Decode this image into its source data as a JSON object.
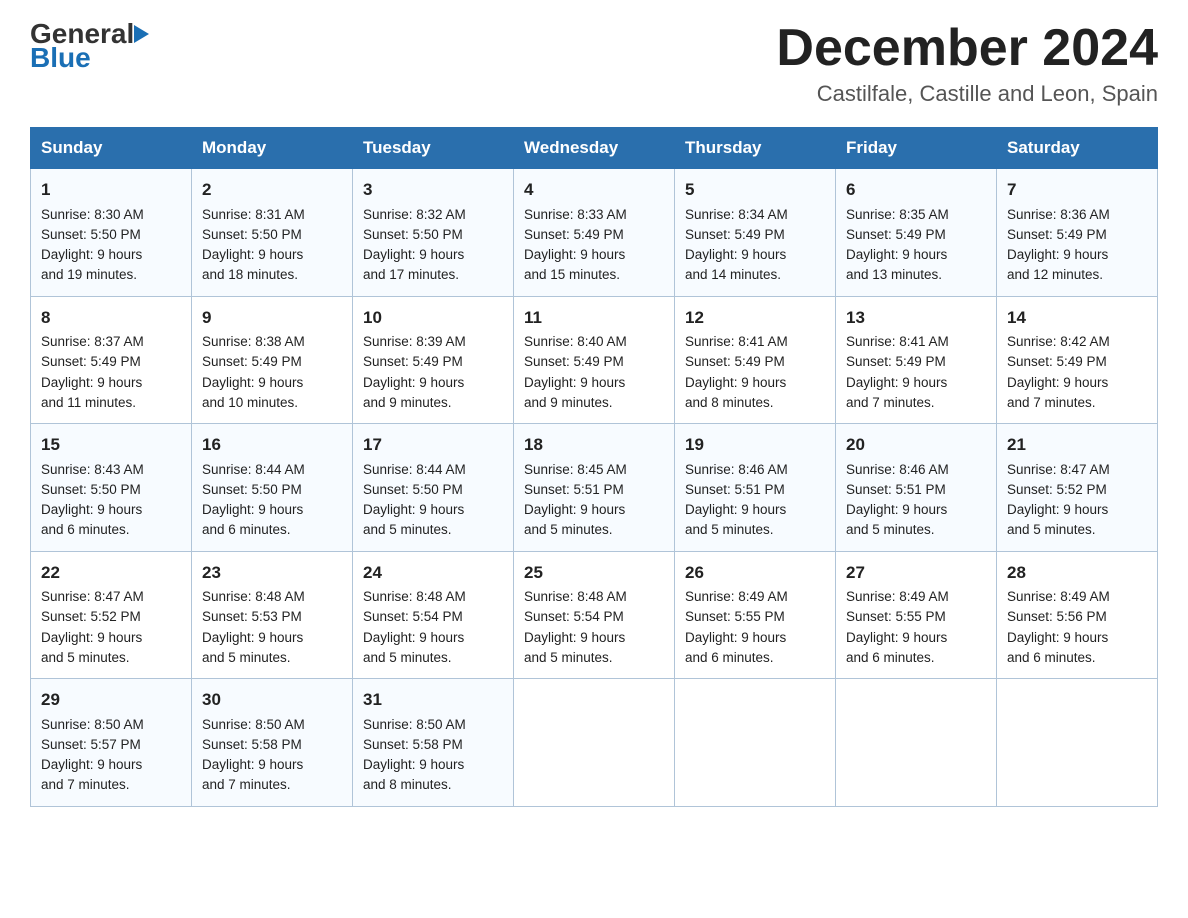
{
  "header": {
    "logo_general": "General",
    "logo_blue": "Blue",
    "main_title": "December 2024",
    "subtitle": "Castilfale, Castille and Leon, Spain"
  },
  "calendar": {
    "days": [
      "Sunday",
      "Monday",
      "Tuesday",
      "Wednesday",
      "Thursday",
      "Friday",
      "Saturday"
    ],
    "weeks": [
      [
        {
          "day": "1",
          "sunrise": "8:30 AM",
          "sunset": "5:50 PM",
          "daylight": "9 hours and 19 minutes."
        },
        {
          "day": "2",
          "sunrise": "8:31 AM",
          "sunset": "5:50 PM",
          "daylight": "9 hours and 18 minutes."
        },
        {
          "day": "3",
          "sunrise": "8:32 AM",
          "sunset": "5:50 PM",
          "daylight": "9 hours and 17 minutes."
        },
        {
          "day": "4",
          "sunrise": "8:33 AM",
          "sunset": "5:49 PM",
          "daylight": "9 hours and 15 minutes."
        },
        {
          "day": "5",
          "sunrise": "8:34 AM",
          "sunset": "5:49 PM",
          "daylight": "9 hours and 14 minutes."
        },
        {
          "day": "6",
          "sunrise": "8:35 AM",
          "sunset": "5:49 PM",
          "daylight": "9 hours and 13 minutes."
        },
        {
          "day": "7",
          "sunrise": "8:36 AM",
          "sunset": "5:49 PM",
          "daylight": "9 hours and 12 minutes."
        }
      ],
      [
        {
          "day": "8",
          "sunrise": "8:37 AM",
          "sunset": "5:49 PM",
          "daylight": "9 hours and 11 minutes."
        },
        {
          "day": "9",
          "sunrise": "8:38 AM",
          "sunset": "5:49 PM",
          "daylight": "9 hours and 10 minutes."
        },
        {
          "day": "10",
          "sunrise": "8:39 AM",
          "sunset": "5:49 PM",
          "daylight": "9 hours and 9 minutes."
        },
        {
          "day": "11",
          "sunrise": "8:40 AM",
          "sunset": "5:49 PM",
          "daylight": "9 hours and 9 minutes."
        },
        {
          "day": "12",
          "sunrise": "8:41 AM",
          "sunset": "5:49 PM",
          "daylight": "9 hours and 8 minutes."
        },
        {
          "day": "13",
          "sunrise": "8:41 AM",
          "sunset": "5:49 PM",
          "daylight": "9 hours and 7 minutes."
        },
        {
          "day": "14",
          "sunrise": "8:42 AM",
          "sunset": "5:49 PM",
          "daylight": "9 hours and 7 minutes."
        }
      ],
      [
        {
          "day": "15",
          "sunrise": "8:43 AM",
          "sunset": "5:50 PM",
          "daylight": "9 hours and 6 minutes."
        },
        {
          "day": "16",
          "sunrise": "8:44 AM",
          "sunset": "5:50 PM",
          "daylight": "9 hours and 6 minutes."
        },
        {
          "day": "17",
          "sunrise": "8:44 AM",
          "sunset": "5:50 PM",
          "daylight": "9 hours and 5 minutes."
        },
        {
          "day": "18",
          "sunrise": "8:45 AM",
          "sunset": "5:51 PM",
          "daylight": "9 hours and 5 minutes."
        },
        {
          "day": "19",
          "sunrise": "8:46 AM",
          "sunset": "5:51 PM",
          "daylight": "9 hours and 5 minutes."
        },
        {
          "day": "20",
          "sunrise": "8:46 AM",
          "sunset": "5:51 PM",
          "daylight": "9 hours and 5 minutes."
        },
        {
          "day": "21",
          "sunrise": "8:47 AM",
          "sunset": "5:52 PM",
          "daylight": "9 hours and 5 minutes."
        }
      ],
      [
        {
          "day": "22",
          "sunrise": "8:47 AM",
          "sunset": "5:52 PM",
          "daylight": "9 hours and 5 minutes."
        },
        {
          "day": "23",
          "sunrise": "8:48 AM",
          "sunset": "5:53 PM",
          "daylight": "9 hours and 5 minutes."
        },
        {
          "day": "24",
          "sunrise": "8:48 AM",
          "sunset": "5:54 PM",
          "daylight": "9 hours and 5 minutes."
        },
        {
          "day": "25",
          "sunrise": "8:48 AM",
          "sunset": "5:54 PM",
          "daylight": "9 hours and 5 minutes."
        },
        {
          "day": "26",
          "sunrise": "8:49 AM",
          "sunset": "5:55 PM",
          "daylight": "9 hours and 6 minutes."
        },
        {
          "day": "27",
          "sunrise": "8:49 AM",
          "sunset": "5:55 PM",
          "daylight": "9 hours and 6 minutes."
        },
        {
          "day": "28",
          "sunrise": "8:49 AM",
          "sunset": "5:56 PM",
          "daylight": "9 hours and 6 minutes."
        }
      ],
      [
        {
          "day": "29",
          "sunrise": "8:50 AM",
          "sunset": "5:57 PM",
          "daylight": "9 hours and 7 minutes."
        },
        {
          "day": "30",
          "sunrise": "8:50 AM",
          "sunset": "5:58 PM",
          "daylight": "9 hours and 7 minutes."
        },
        {
          "day": "31",
          "sunrise": "8:50 AM",
          "sunset": "5:58 PM",
          "daylight": "9 hours and 8 minutes."
        },
        null,
        null,
        null,
        null
      ]
    ],
    "labels": {
      "sunrise": "Sunrise:",
      "sunset": "Sunset:",
      "daylight": "Daylight:"
    }
  }
}
